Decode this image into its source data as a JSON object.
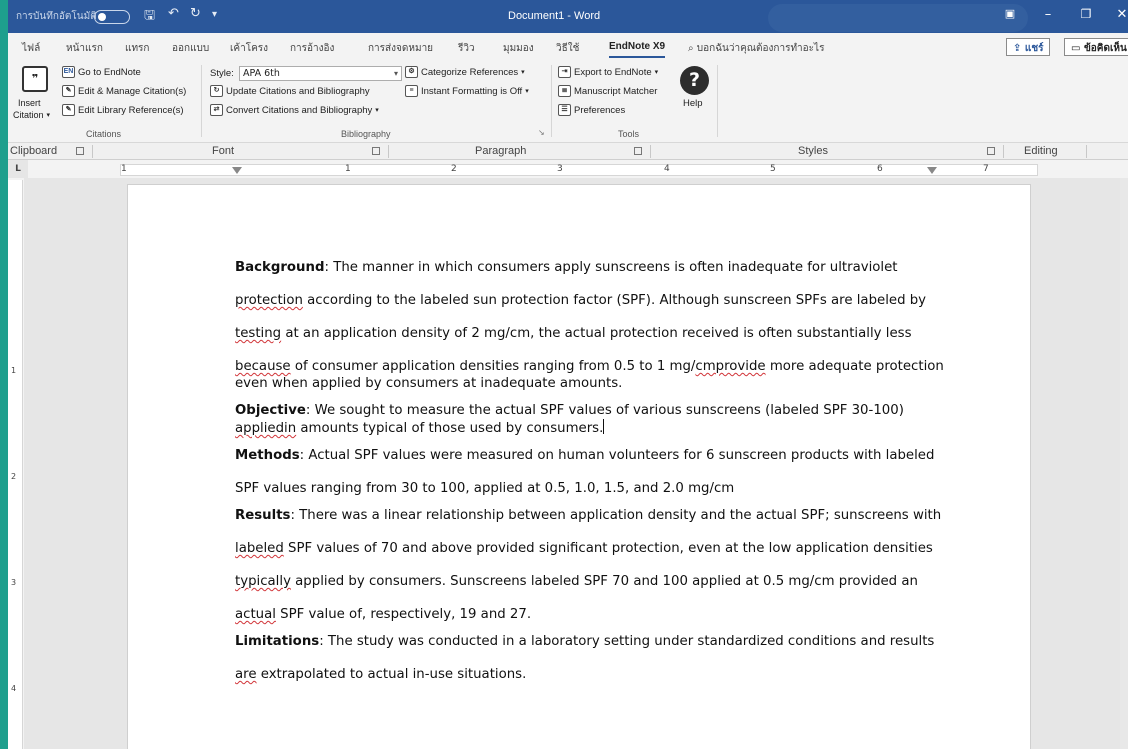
{
  "titlebar": {
    "autosave": "การบันทึกอัตโนมัติ",
    "title": "Document1  -  Word",
    "save_icon": "save-icon",
    "undo_icon": "undo-icon",
    "redo_icon": "redo-icon",
    "qat_more": "customize-qat-icon",
    "window_btns": [
      "ribbon-display-icon",
      "minimize-icon",
      "restore-icon",
      "close-icon"
    ]
  },
  "tabs": [
    "ไฟล์",
    "หน้าแรก",
    "แทรก",
    "ออกแบบ",
    "เค้าโครง",
    "การอ้างอิง",
    "การส่งจดหมาย",
    "รีวิว",
    "มุมมอง",
    "วิธีใช้",
    "EndNote X9"
  ],
  "tell_me": "บอกฉันว่าคุณต้องการทำอะไร",
  "share": "แชร์",
  "comments": "ข้อคิดเห็น",
  "ribbon": {
    "insert_citation_1": "Insert",
    "insert_citation_2": "Citation",
    "go_to_endnote": "Go to EndNote",
    "edit_manage": "Edit & Manage Citation(s)",
    "edit_library": "Edit Library Reference(s)",
    "citations_group": "Citations",
    "style_label": "Style:",
    "style_value": "APA 6th",
    "update_citations": "Update Citations and Bibliography",
    "convert_citations": "Convert Citations and Bibliography",
    "categorize": "Categorize References",
    "instant_formatting": "Instant Formatting is Off",
    "bibliography_group": "Bibliography",
    "export_endnote": "Export to EndNote",
    "manuscript_matcher": "Manuscript Matcher",
    "preferences": "Preferences",
    "help": "Help",
    "tools_group": "Tools"
  },
  "groups": {
    "clipboard": "Clipboard",
    "font": "Font",
    "paragraph": "Paragraph",
    "styles": "Styles",
    "editing": "Editing"
  },
  "ruler": {
    "corner": "L",
    "h_nums": [
      "1",
      "1",
      "2",
      "3",
      "4",
      "5",
      "6",
      "7"
    ],
    "v_nums": [
      "1",
      "2",
      "3",
      "4"
    ]
  },
  "document": {
    "background_head": "Background",
    "background_lines": [
      ": The manner in which consumers apply sunscreens is often inadequate for ultraviolet",
      " according to the labeled sun protection factor (SPF). Although sunscreen SPFs are labeled by",
      " at an application density of 2 mg/cm, the actual protection received is often substantially less",
      " of consumer application densities ranging from 0.5 to 1 mg/",
      " more adequate protection",
      "even when applied by consumers at inadequate amounts."
    ],
    "background_squig": [
      "protection",
      "testing",
      "because",
      "cmprovide"
    ],
    "objective_head": "Objective",
    "objective_lines": [
      ": We sought to measure the actual SPF values of various sunscreens (labeled SPF 30-100)",
      " amounts typical of those used by consumers."
    ],
    "objective_squig": "appliedin",
    "methods_head": "Methods",
    "methods_lines": [
      ": Actual SPF values were measured on human volunteers for 6 sunscreen products with labeled",
      "SPF values ranging from 30 to 100, applied at 0.5, 1.0, 1.5, and 2.0 mg/cm"
    ],
    "results_head": "Results",
    "results_lines": [
      ": There was a linear relationship between application density and the actual SPF; sunscreens with",
      " SPF values of 70 and above provided significant protection, even at the low application densities",
      " applied by consumers. Sunscreens labeled SPF 70 and 100 applied at 0.5 mg/cm provided an",
      " SPF value of, respectively, 19 and 27."
    ],
    "results_squig": [
      "labeled",
      "typically",
      "actual"
    ],
    "limitations_head": "Limitations",
    "limitations_lines": [
      ": The study was conducted in a laboratory setting under standardized conditions and results",
      " extrapolated to actual in-use situations."
    ],
    "limitations_squig": "are"
  }
}
